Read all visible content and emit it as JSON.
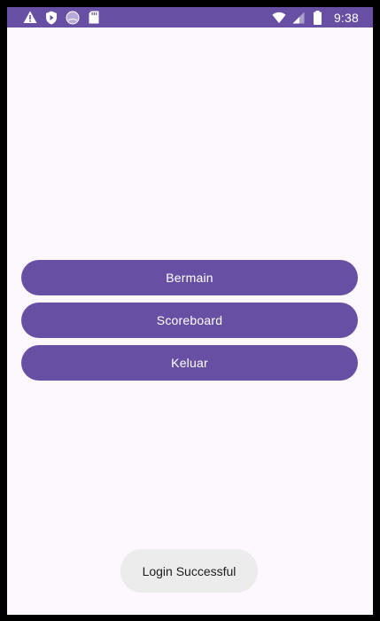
{
  "status_bar": {
    "time": "9:38",
    "left_icons": [
      "warning-icon",
      "shield-play-icon",
      "circle-app-icon",
      "sd-card-icon"
    ],
    "right_icons": [
      "wifi-icon",
      "cell-signal-icon",
      "battery-icon"
    ]
  },
  "menu": {
    "play_label": "Bermain",
    "scoreboard_label": "Scoreboard",
    "exit_label": "Keluar"
  },
  "toast": {
    "message": "Login Successful"
  },
  "colors": {
    "primary": "#6750a4",
    "background": "#fdf7fe",
    "toast_bg": "#ececec",
    "frame": "#000000"
  }
}
